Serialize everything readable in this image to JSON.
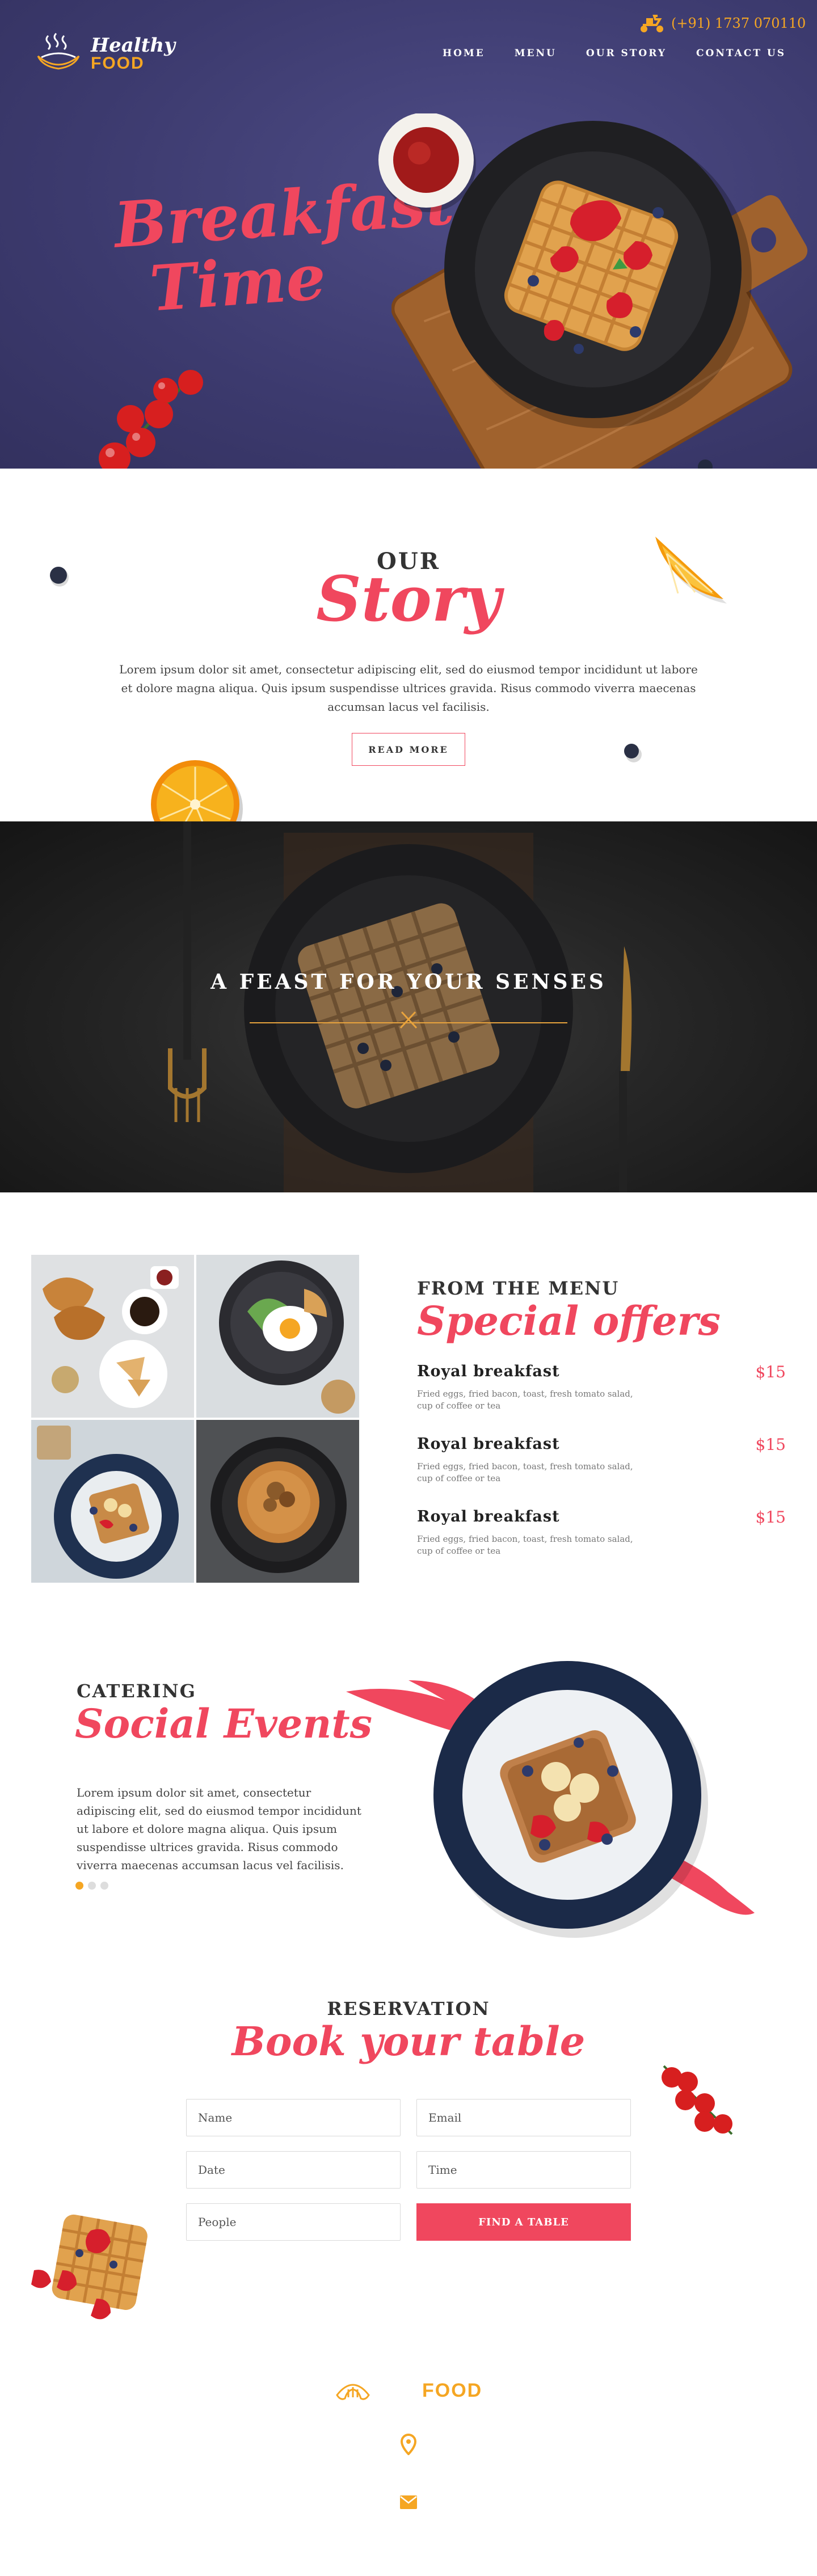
{
  "brand": {
    "logo_line1": "Healthy",
    "logo_line2": "FOOD",
    "accent_color": "#f0475e",
    "gold_color": "#f5a623"
  },
  "header": {
    "phone": "(+91) 1737 070110",
    "nav": [
      "HOME",
      "MENU",
      "OUR STORY",
      "CONTACT US"
    ]
  },
  "hero": {
    "title_line1": "Breakfast",
    "title_line2": "Time"
  },
  "story": {
    "kicker": "OUR",
    "title": "Story",
    "text": "Lorem ipsum dolor sit amet, consectetur adipiscing elit, sed do eiusmod tempor incididunt ut labore et dolore magna aliqua. Quis ipsum suspendisse ultrices gravida. Risus commodo viverra maecenas accumsan lacus vel facilisis.",
    "button": "READ MORE"
  },
  "feast": {
    "title": "A FEAST FOR YOUR SENSES"
  },
  "menu": {
    "kicker": "FROM THE MENU",
    "title": "Special offers",
    "items": [
      {
        "name": "Royal breakfast",
        "price": "$15",
        "desc": "Fried eggs, fried bacon, toast, fresh tomato salad, cup of coffee or tea"
      },
      {
        "name": "Royal breakfast",
        "price": "$15",
        "desc": "Fried eggs, fried bacon, toast, fresh tomato salad, cup of coffee or tea"
      },
      {
        "name": "Royal breakfast",
        "price": "$15",
        "desc": "Fried eggs, fried bacon, toast, fresh tomato salad, cup of coffee or tea"
      }
    ]
  },
  "catering": {
    "kicker": "CATERING",
    "title": "Social Events",
    "text": "Lorem ipsum dolor sit amet, consectetur adipiscing elit, sed do eiusmod tempor incididunt ut labore et dolore magna aliqua. Quis ipsum suspendisse ultrices gravida. Risus commodo viverra maecenas accumsan lacus vel facilisis."
  },
  "reservation": {
    "kicker": "RESERVATION",
    "title": "Book your table",
    "fields": {
      "name": "Name",
      "email": "Email",
      "date": "Date",
      "time": "Time",
      "people": "People"
    },
    "button": "FIND A TABLE"
  },
  "footer": {
    "logo_text": "FOOD"
  },
  "icons": [
    "coffee-cup-icon",
    "scooter-icon",
    "croissant-icon",
    "location-pin-icon",
    "envelope-icon"
  ]
}
